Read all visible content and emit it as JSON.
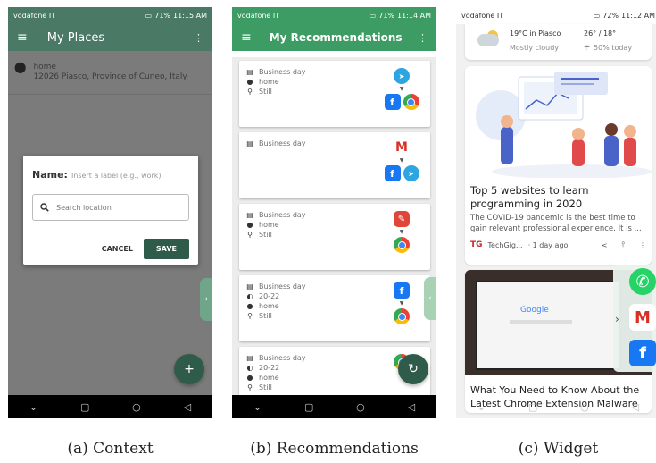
{
  "status_bars": {
    "a": {
      "carrier": "vodafone IT",
      "battery": "71%",
      "time": "11:15 AM"
    },
    "b": {
      "carrier": "vodafone IT",
      "battery": "71%",
      "time": "11:14 AM"
    },
    "c": {
      "carrier": "vodafone IT",
      "battery": "72%",
      "time": "11:12 AM"
    }
  },
  "context": {
    "title": "My Places",
    "place": {
      "name": "home",
      "address": "12026 Piasco, Province of Cuneo, Italy"
    },
    "dialog": {
      "name_label": "Name:",
      "name_placeholder": "Insert a label (e.g., work)",
      "search_placeholder": "Search location",
      "cancel": "CANCEL",
      "save": "SAVE"
    },
    "fab": "+",
    "colors": {
      "toolbar": "#4a7a66",
      "save": "#2f5c4a"
    }
  },
  "recommendations": {
    "title": "My Recommendations",
    "cards": [
      {
        "conds": [
          "Business day",
          "home",
          "Still"
        ]
      },
      {
        "conds": [
          "Business day"
        ]
      },
      {
        "conds": [
          "Business day",
          "home",
          "Still"
        ]
      },
      {
        "conds": [
          "Business day",
          "20-22",
          "home",
          "Still"
        ]
      },
      {
        "conds": [
          "Business day",
          "20-22",
          "home",
          "Still"
        ]
      }
    ],
    "colors": {
      "toolbar": "#3d9c64"
    }
  },
  "widget": {
    "weather": {
      "temp_label": "19°C in Piasco",
      "range": "26° / 18°",
      "condition": "Mostly cloudy",
      "rain": "50% today"
    },
    "articles": [
      {
        "title": "Top 5 websites to learn programming in 2020",
        "snippet": "The COVID-19 pandemic is the best time to gain relevant professional experience. It is ...",
        "source_logo": "TG",
        "source": "TechGig...",
        "age": "· 1 day ago"
      },
      {
        "title": "What You Need to Know About the Latest Chrome Extension Malware Campaign",
        "screen_text": "Google"
      }
    ]
  },
  "captions": [
    "(a) Context",
    "(b) Recommendations",
    "(c) Widget"
  ]
}
